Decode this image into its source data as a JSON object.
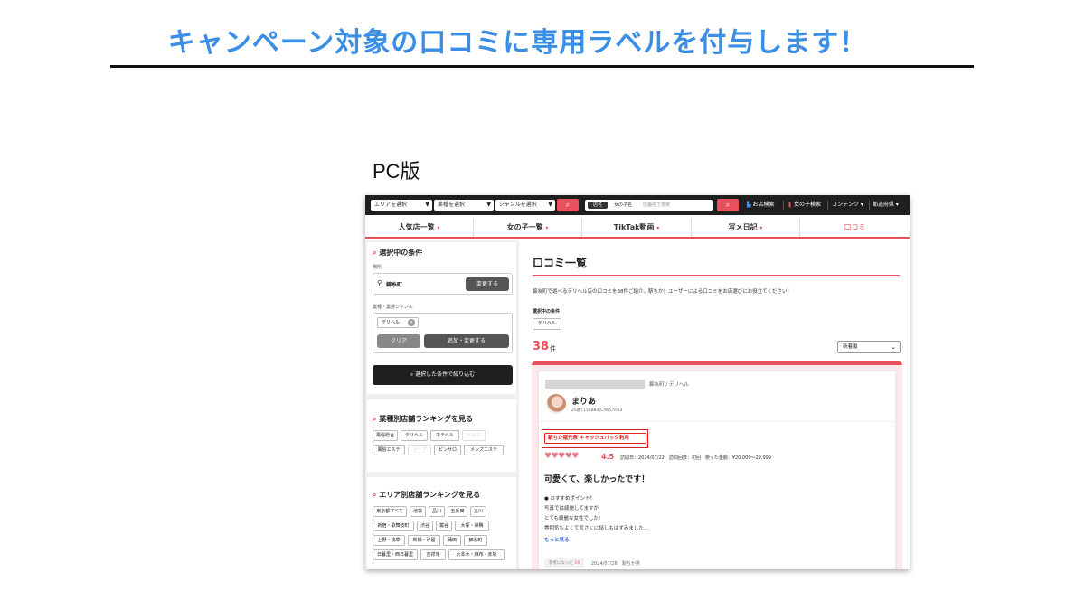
{
  "slide": {
    "title": "キャンペーン対象の口コミに専用ラベルを付与します！",
    "version_label": "PC版"
  },
  "topbar": {
    "area_select": "エリアを選択",
    "industry_select": "業種を選択",
    "genre_select": "ジャンルを選択",
    "search_icon": "search-icon",
    "search_mode_shop": "店名",
    "search_mode_girl": "女の子名",
    "search_placeholder": "店舗名で検索",
    "shop_search_link": "お店検索",
    "girl_search_link": "女の子検索",
    "contents_menu": "コンテンツ",
    "prefecture_menu": "都道府県"
  },
  "tabs": [
    {
      "label": "人気店一覧"
    },
    {
      "label": "女の子一覧"
    },
    {
      "label": "TikTak動画"
    },
    {
      "label": "写メ日記"
    },
    {
      "label": "口コミ"
    }
  ],
  "tab_dot": "▾",
  "sidebar": {
    "conditions_title": "選択中の条件",
    "place_label": "場所",
    "location": "錦糸町",
    "change_button": "変更する",
    "industry_genre_label": "業種・業態ジャンル",
    "genre_chip": "デリヘル",
    "clear_button": "クリア",
    "add_change_button": "追加・変更する",
    "filter_button": "選択した条件で絞り込む",
    "industry_ranking_title": "業種別店舗ランキングを見る",
    "industry_chips": [
      "風俗総合",
      "デリヘル",
      "ホテヘル",
      "ヘルス",
      "風俗エステ",
      "ソープ",
      "ピンサロ",
      "メンズエステ"
    ],
    "area_ranking_title": "エリア別店舗ランキングを見る",
    "area_chips": [
      "東京都すべて",
      "池袋",
      "品川",
      "五反田",
      "立川",
      "新宿・歌舞伎町",
      "渋谷",
      "鶯谷",
      "大塚・巣鴨",
      "上野・浅草",
      "新橋・汐留",
      "蒲田",
      "錦糸町",
      "日暮里・西日暮里",
      "吉祥寺",
      "六本木・麻布・赤坂"
    ]
  },
  "main": {
    "title": "口コミ一覧",
    "description": "錦糸町で遊べるデリヘル店の口コミを38件ご紹介。駅ちか！ユーザーによる口コミをお店選びにお役立てください！",
    "selected_conditions_label": "選択中の条件",
    "selected_chip": "デリヘル",
    "count": "38",
    "count_unit": "件",
    "sort_value": "新着順"
  },
  "review": {
    "shop_meta": "錦糸町 / デリヘル",
    "reviewer_name": "まりあ",
    "reviewer_id": "25歳T156B84(C)W57H83",
    "campaign_label": "駅ちか還元祭 キャッシュバック利用",
    "hearts": "♥♥♥♥♥",
    "rating": "4.5",
    "visit_meta": "訪問日：2024/07/22　訪問回数：初回　使った金額：¥20,000～29,999",
    "headline": "可愛くて、楽しかったです！",
    "point_heading": "● おすすめポイント！",
    "body_lines": [
      "写真では綺麗してますが",
      "とても綺麗な女性でした!",
      "雰囲気もよくて気さくに話しもはずみました…"
    ],
    "more_link": "もっと見る",
    "helpful_label": "参考になった",
    "helpful_count": "19",
    "posted": "2024/07/26　駅ちか男"
  }
}
